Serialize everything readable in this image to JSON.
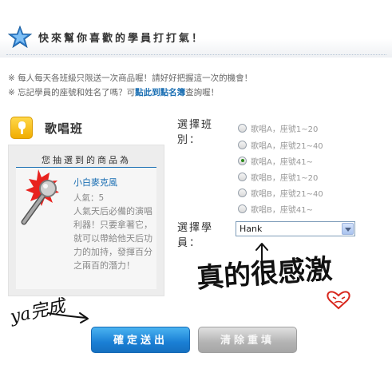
{
  "header": {
    "title": "快來幫你喜歡的學員打打氣！",
    "icon": "star-icon"
  },
  "notices": {
    "line1": "※ 每人每天各班級只限送一次商品喔！請好好把握這一次的機會！",
    "line2_prefix": "※ 忘記學員的座號和姓名了嗎？可",
    "line2_link": "點此到點名簿",
    "line2_suffix": "查詢喔！"
  },
  "class_section": {
    "title": "歌唱班",
    "icon": "microphone-badge-icon"
  },
  "prize": {
    "heading": "您抽選到的商品為",
    "product_name": "小白麥克風",
    "popularity": "人氣：5",
    "description": "人氣天后必備的演唱利器！只要拿著它，就可以帶給他天后功力的加持，發揮百分之兩百的潛力！"
  },
  "form": {
    "class_label": "選擇班別：",
    "student_label": "選擇學員：",
    "class_options": [
      {
        "label": "歌唱A，座號1~20",
        "checked": false
      },
      {
        "label": "歌唱A，座號21~40",
        "checked": false
      },
      {
        "label": "歌唱A，座號41~",
        "checked": true
      },
      {
        "label": "歌唱B，座號1~20",
        "checked": false
      },
      {
        "label": "歌唱B，座號21~40",
        "checked": false
      },
      {
        "label": "歌唱B，座號41~",
        "checked": false
      }
    ],
    "student_selected": "Hank"
  },
  "buttons": {
    "submit": "確定送出",
    "reset": "清除重填"
  },
  "handwriting": {
    "done_note": "ya完成",
    "thanks_note": "真的很感激"
  },
  "colors": {
    "accent_blue": "#1b6fb3",
    "submit_blue": "#1a7fd5",
    "reset_gray": "#b3b3b3",
    "icon_yellow": "#f1ad00"
  }
}
